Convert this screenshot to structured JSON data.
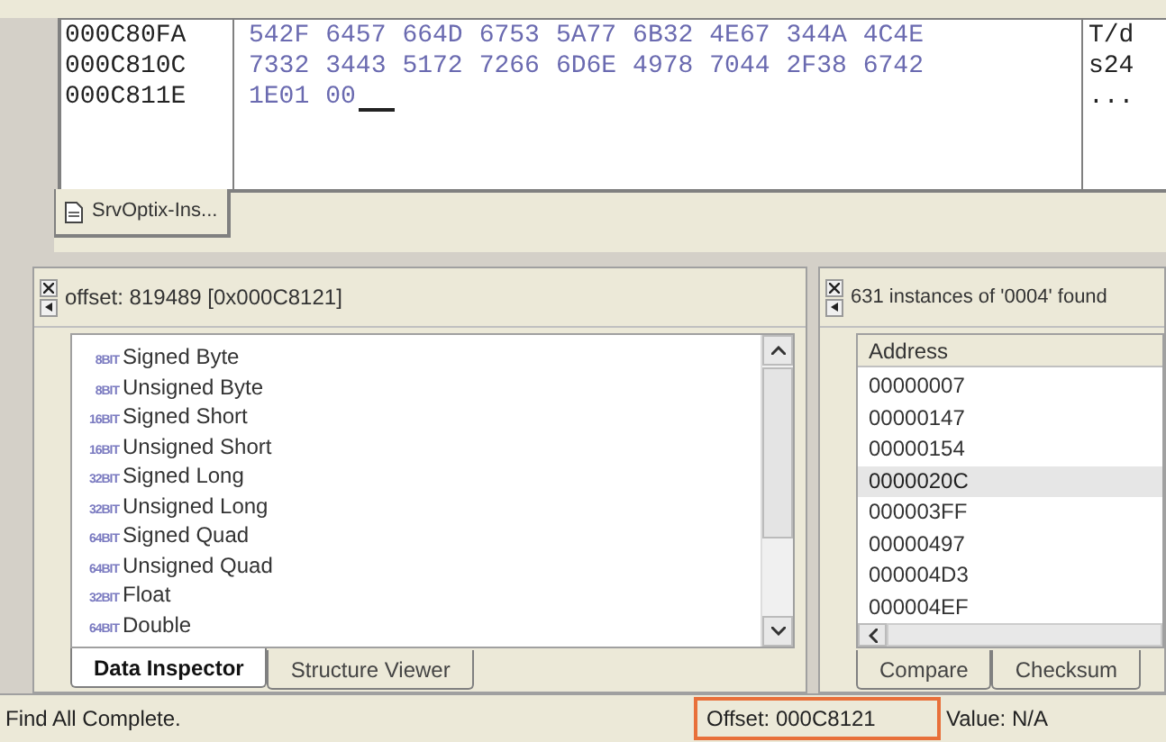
{
  "hex_view": {
    "rows": [
      {
        "address": "000C80FA",
        "bytes": [
          "542F",
          "6457",
          "664D",
          "6753",
          "5A77",
          "6B32",
          "4E67",
          "344A",
          "4C4E"
        ],
        "text": "T/d",
        "cursor": false
      },
      {
        "address": "000C810C",
        "bytes": [
          "7332",
          "3443",
          "5172",
          "7266",
          "6D6E",
          "4978",
          "7044",
          "2F38",
          "6742"
        ],
        "text": "s24",
        "cursor": false
      },
      {
        "address": "000C811E",
        "bytes": [
          "1E01",
          "00"
        ],
        "text": "...",
        "cursor": true
      }
    ]
  },
  "document_tabs": [
    {
      "label": "SrvOptix-Ins...",
      "selected": true
    }
  ],
  "data_inspector": {
    "header": "offset: 819489 [0x000C8121]",
    "items": [
      {
        "bits": "8BIT",
        "label": "Signed Byte"
      },
      {
        "bits": "8BIT",
        "label": "Unsigned Byte"
      },
      {
        "bits": "16BIT",
        "label": "Signed Short"
      },
      {
        "bits": "16BIT",
        "label": "Unsigned Short"
      },
      {
        "bits": "32BIT",
        "label": "Signed Long"
      },
      {
        "bits": "32BIT",
        "label": "Unsigned Long"
      },
      {
        "bits": "64BIT",
        "label": "Signed Quad"
      },
      {
        "bits": "64BIT",
        "label": "Unsigned Quad"
      },
      {
        "bits": "32BIT",
        "label": "Float"
      },
      {
        "bits": "64BIT",
        "label": "Double"
      }
    ],
    "tabs": [
      {
        "label": "Data Inspector",
        "selected": true
      },
      {
        "label": "Structure Viewer",
        "selected": false
      }
    ]
  },
  "find_results": {
    "header": "631 instances of '0004' found",
    "column": "Address",
    "rows": [
      {
        "address": "00000007",
        "selected": false
      },
      {
        "address": "00000147",
        "selected": false
      },
      {
        "address": "00000154",
        "selected": false
      },
      {
        "address": "0000020C",
        "selected": true
      },
      {
        "address": "000003FF",
        "selected": false
      },
      {
        "address": "00000497",
        "selected": false
      },
      {
        "address": "000004D3",
        "selected": false
      },
      {
        "address": "000004EF",
        "selected": false
      }
    ],
    "tabs": [
      {
        "label": "Compare",
        "selected": false
      },
      {
        "label": "Checksum",
        "selected": false
      }
    ]
  },
  "status_bar": {
    "message": "Find All Complete.",
    "offset": "Offset: 000C8121",
    "value": "Value: N/A",
    "offset_highlighted": true
  }
}
